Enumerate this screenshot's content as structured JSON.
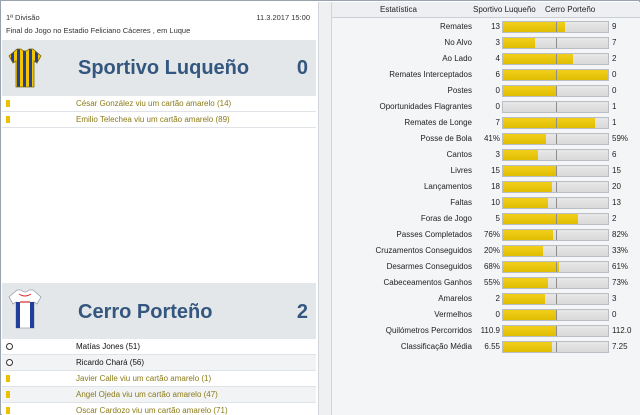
{
  "match": {
    "competition": "1ª Divisão",
    "date": "11.3.2017 15:00",
    "description": "Final do Jogo no Estadio Feliciano Cáceres , em Luque"
  },
  "home": {
    "name": "Sportivo Luqueño",
    "score": "0",
    "shirt_colors": [
      "#f2c500",
      "#1f3f9a"
    ],
    "events": [
      {
        "type": "card",
        "icon": "yellow-card-icon",
        "text": "César González viu um cartão amarelo (14)"
      },
      {
        "type": "card",
        "icon": "yellow-card-icon",
        "text": "Emilio Telechea viu um cartão amarelo (89)"
      }
    ]
  },
  "away": {
    "name": "Cerro Porteño",
    "score": "2",
    "shirt_colors": [
      "#ffffff",
      "#1f3f9a",
      "#d22b2b"
    ],
    "events": [
      {
        "type": "goal",
        "icon": "ball-icon",
        "text": "Matías Jones (51)"
      },
      {
        "type": "goal",
        "icon": "ball-icon",
        "text": "Ricardo Chará (56)"
      },
      {
        "type": "card",
        "icon": "yellow-card-icon",
        "text": "Javier Calle viu um cartão amarelo (1)"
      },
      {
        "type": "card",
        "icon": "yellow-card-icon",
        "text": "Angel Ojeda viu um cartão amarelo (47)"
      },
      {
        "type": "card",
        "icon": "yellow-card-icon",
        "text": "Oscar Cardozo viu um cartão amarelo (71)"
      }
    ]
  },
  "stats": {
    "header": {
      "label": "Estatística",
      "home": "Sportivo Luqueño",
      "away": "Cerro Porteño"
    },
    "bar_color": "#e0bd00",
    "rows": [
      {
        "label": "Remates",
        "home": "13",
        "away": "9",
        "home_share": 0.59
      },
      {
        "label": "No Alvo",
        "home": "3",
        "away": "7",
        "home_share": 0.3
      },
      {
        "label": "Ao Lado",
        "home": "4",
        "away": "2",
        "home_share": 0.67
      },
      {
        "label": "Remates Interceptados",
        "home": "6",
        "away": "0",
        "home_share": 1.0
      },
      {
        "label": "Postes",
        "home": "0",
        "away": "0",
        "home_share": 0.5
      },
      {
        "label": "Oportunidades Flagrantes",
        "home": "0",
        "away": "1",
        "home_share": 0.0
      },
      {
        "label": "Remates de Longe",
        "home": "7",
        "away": "1",
        "home_share": 0.88
      },
      {
        "label": "Posse de Bola",
        "home": "41%",
        "away": "59%",
        "home_share": 0.41
      },
      {
        "label": "Cantos",
        "home": "3",
        "away": "6",
        "home_share": 0.33
      },
      {
        "label": "Livres",
        "home": "15",
        "away": "15",
        "home_share": 0.5
      },
      {
        "label": "Lançamentos",
        "home": "18",
        "away": "20",
        "home_share": 0.47
      },
      {
        "label": "Faltas",
        "home": "10",
        "away": "13",
        "home_share": 0.43
      },
      {
        "label": "Foras de Jogo",
        "home": "5",
        "away": "2",
        "home_share": 0.71
      },
      {
        "label": "Passes Completados",
        "home": "76%",
        "away": "82%",
        "home_share": 0.48
      },
      {
        "label": "Cruzamentos Conseguidos",
        "home": "20%",
        "away": "33%",
        "home_share": 0.38
      },
      {
        "label": "Desarmes Conseguidos",
        "home": "68%",
        "away": "61%",
        "home_share": 0.53
      },
      {
        "label": "Cabeceamentos Ganhos",
        "home": "55%",
        "away": "73%",
        "home_share": 0.43
      },
      {
        "label": "Amarelos",
        "home": "2",
        "away": "3",
        "home_share": 0.4
      },
      {
        "label": "Vermelhos",
        "home": "0",
        "away": "0",
        "home_share": 0.5
      },
      {
        "label": "Quilómetros Percorridos",
        "home": "110.9",
        "away": "112.0",
        "home_share": 0.5
      },
      {
        "label": "Classificação Média",
        "home": "6.55",
        "away": "7.25",
        "home_share": 0.47
      }
    ]
  }
}
